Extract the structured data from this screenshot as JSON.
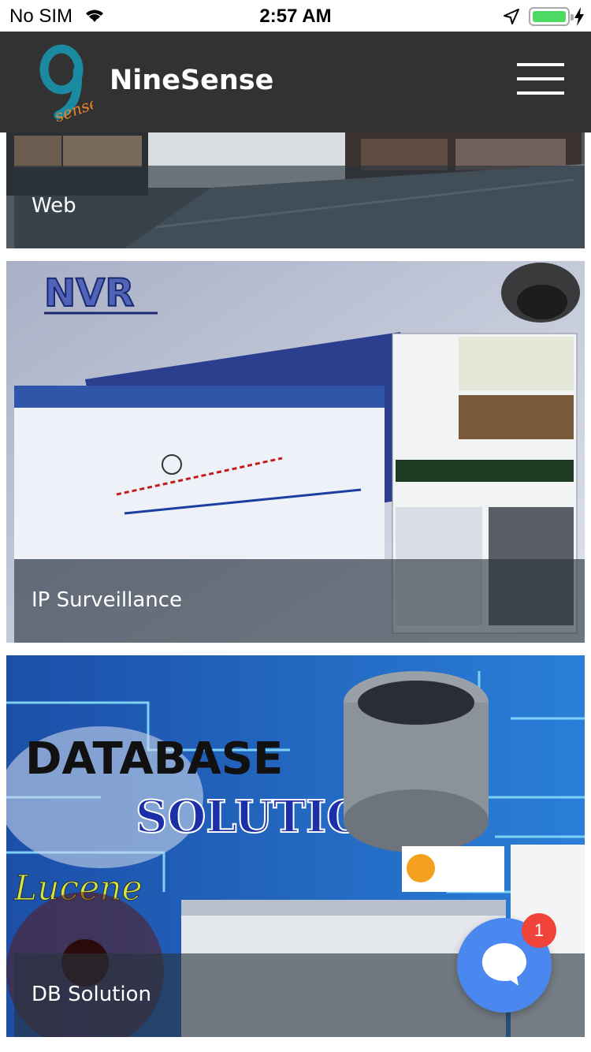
{
  "status_bar": {
    "carrier": "No SIM",
    "time": "2:57 AM",
    "icons": [
      "wifi-icon",
      "location-arrow-icon",
      "battery-icon",
      "charging-bolt-icon"
    ],
    "battery_level": 1.0
  },
  "header": {
    "brand": "NineSense",
    "logo_icon": "ninesense-logo",
    "menu_icon": "hamburger-icon"
  },
  "cards": [
    {
      "label": "Web"
    },
    {
      "label": "IP Surveillance"
    },
    {
      "label": "DB Solution"
    }
  ],
  "chat": {
    "icon": "chat-bubble-icon",
    "badge_count": "1"
  },
  "colors": {
    "navbar": "#323232",
    "battery_fill": "#4cd964",
    "chat_button": "#4a88ef",
    "badge": "#f0443a"
  }
}
